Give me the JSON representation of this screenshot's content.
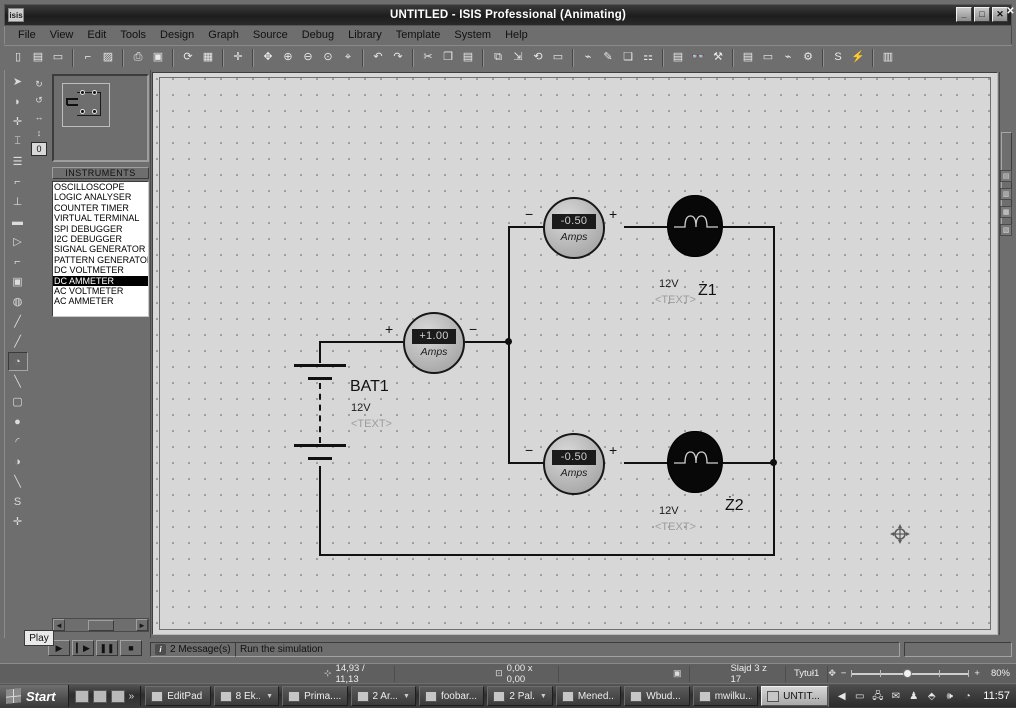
{
  "window": {
    "app_icon_label": "isis",
    "title": "UNTITLED - ISIS Professional (Animating)",
    "minimize": "_",
    "maximize": "□",
    "close": "✕",
    "outer_close": "✕"
  },
  "menu": {
    "items": [
      "File",
      "View",
      "Edit",
      "Tools",
      "Design",
      "Graph",
      "Source",
      "Debug",
      "Library",
      "Template",
      "System",
      "Help"
    ]
  },
  "toolbar": {
    "groups": [
      {
        "buttons": [
          {
            "name": "new-file-button",
            "icon": "new-document-icon",
            "glyph": "▯"
          },
          {
            "name": "open-file-button",
            "icon": "open-folder-icon",
            "glyph": "▤"
          },
          {
            "name": "save-file-button",
            "icon": "save-disk-icon",
            "glyph": "▭"
          }
        ]
      },
      {
        "buttons": [
          {
            "name": "import-section-button",
            "icon": "import-icon",
            "glyph": "⌐"
          },
          {
            "name": "export-section-button",
            "icon": "export-icon",
            "glyph": "▨"
          }
        ]
      },
      {
        "buttons": [
          {
            "name": "print-button",
            "icon": "printer-icon",
            "glyph": "⎙"
          },
          {
            "name": "print-area-button",
            "icon": "print-area-icon",
            "glyph": "▣"
          }
        ]
      },
      {
        "buttons": [
          {
            "name": "refresh-button",
            "icon": "refresh-icon",
            "glyph": "⟳"
          },
          {
            "name": "toggle-grid-button",
            "icon": "grid-icon",
            "glyph": "▦"
          }
        ]
      },
      {
        "buttons": [
          {
            "name": "origin-button",
            "icon": "crosshair-origin-icon",
            "glyph": "✛"
          }
        ]
      },
      {
        "buttons": [
          {
            "name": "pan-button",
            "icon": "pan-move-icon",
            "glyph": "✥"
          },
          {
            "name": "zoom-in-button",
            "icon": "zoom-in-icon",
            "glyph": "⊕"
          },
          {
            "name": "zoom-out-button",
            "icon": "zoom-out-icon",
            "glyph": "⊖"
          },
          {
            "name": "zoom-all-button",
            "icon": "zoom-fit-icon",
            "glyph": "⊙"
          },
          {
            "name": "zoom-area-button",
            "icon": "zoom-area-icon",
            "glyph": "⌖"
          }
        ]
      },
      {
        "buttons": [
          {
            "name": "undo-button",
            "icon": "undo-arrow-icon",
            "glyph": "↶"
          },
          {
            "name": "redo-button",
            "icon": "redo-arrow-icon",
            "glyph": "↷"
          }
        ]
      },
      {
        "buttons": [
          {
            "name": "cut-button",
            "icon": "scissors-icon",
            "glyph": "✂"
          },
          {
            "name": "copy-button",
            "icon": "copy-pages-icon",
            "glyph": "❐"
          },
          {
            "name": "paste-button",
            "icon": "clipboard-icon",
            "glyph": "▤"
          }
        ]
      },
      {
        "buttons": [
          {
            "name": "block-copy-button",
            "icon": "block-copy-icon",
            "glyph": "⧉"
          },
          {
            "name": "block-move-button",
            "icon": "block-move-icon",
            "glyph": "⇲"
          },
          {
            "name": "block-rotate-button",
            "icon": "block-rotate-icon",
            "glyph": "⟲"
          },
          {
            "name": "block-delete-button",
            "icon": "block-delete-icon",
            "glyph": "▭"
          }
        ]
      },
      {
        "buttons": [
          {
            "name": "pick-device-button",
            "icon": "pick-device-icon",
            "glyph": "⌁"
          },
          {
            "name": "make-device-button",
            "icon": "make-device-icon",
            "glyph": "✎"
          },
          {
            "name": "packaging-tool-button",
            "icon": "packaging-icon",
            "glyph": "❏"
          },
          {
            "name": "decompose-button",
            "icon": "decompose-icon",
            "glyph": "⚏"
          }
        ]
      },
      {
        "buttons": [
          {
            "name": "netlist-button",
            "icon": "netlist-icon",
            "glyph": "▤"
          },
          {
            "name": "search-tag-button",
            "icon": "binoculars-icon",
            "glyph": "👓"
          },
          {
            "name": "property-assignment-button",
            "icon": "property-tool-icon",
            "glyph": "⚒"
          }
        ]
      },
      {
        "buttons": [
          {
            "name": "bom-report-button",
            "icon": "bill-of-materials-icon",
            "glyph": "▤"
          },
          {
            "name": "erc-report-button",
            "icon": "erc-icon",
            "glyph": "▭"
          },
          {
            "name": "netlist-compile-button",
            "icon": "compile-icon",
            "glyph": "⌁"
          },
          {
            "name": "ares-button",
            "icon": "ares-pcb-icon",
            "glyph": "⚙"
          }
        ]
      },
      {
        "buttons": [
          {
            "name": "spice-model-button",
            "icon": "spice-icon",
            "glyph": "S"
          },
          {
            "name": "graph-sim-button",
            "icon": "graph-sim-icon",
            "glyph": "⚡"
          }
        ]
      },
      {
        "buttons": [
          {
            "name": "3d-visualizer-button",
            "icon": "three-d-icon",
            "glyph": "▥"
          }
        ]
      }
    ]
  },
  "mode_toolbar": {
    "buttons": [
      {
        "name": "selection-mode-button",
        "icon": "arrow-pointer-icon",
        "glyph": "➤",
        "selected": false
      },
      {
        "name": "component-mode-button",
        "icon": "component-icon",
        "glyph": "◗",
        "selected": false
      },
      {
        "name": "junction-dot-mode-button",
        "icon": "junction-dot-icon",
        "glyph": "✛",
        "selected": false
      },
      {
        "name": "wire-label-mode-button",
        "icon": "wire-label-icon",
        "glyph": "⌶",
        "selected": false
      },
      {
        "name": "text-script-mode-button",
        "icon": "text-script-icon",
        "glyph": "☰",
        "selected": false
      },
      {
        "name": "bus-mode-button",
        "icon": "bus-icon",
        "glyph": "⌐",
        "selected": false
      },
      {
        "name": "subcircuit-mode-button",
        "icon": "subcircuit-icon",
        "glyph": "⊥",
        "selected": false
      },
      {
        "name": "terminals-mode-button",
        "icon": "terminal-icon",
        "glyph": "▬",
        "selected": false
      },
      {
        "name": "device-pin-mode-button",
        "icon": "device-pin-icon",
        "glyph": "▷",
        "selected": false
      },
      {
        "name": "graph-mode-button",
        "icon": "graph-icon",
        "glyph": "⌐",
        "selected": false
      },
      {
        "name": "tape-recorder-mode-button",
        "icon": "tape-recorder-icon",
        "glyph": "▣",
        "selected": false
      },
      {
        "name": "generator-mode-button",
        "icon": "generator-icon",
        "glyph": "◍",
        "selected": false
      },
      {
        "name": "voltage-probe-mode-button",
        "icon": "voltage-probe-icon",
        "glyph": "╱",
        "selected": false
      },
      {
        "name": "current-probe-mode-button",
        "icon": "current-probe-icon",
        "glyph": "╱",
        "selected": false
      },
      {
        "name": "virtual-instruments-mode-button",
        "icon": "instrument-icon",
        "glyph": "◔",
        "selected": true
      },
      {
        "name": "line-mode-button",
        "icon": "line-tool-icon",
        "glyph": "╲",
        "selected": false
      },
      {
        "name": "box-mode-button",
        "icon": "box-tool-icon",
        "glyph": "▢",
        "selected": false
      },
      {
        "name": "circle-mode-button",
        "icon": "circle-tool-icon",
        "glyph": "●",
        "selected": false
      },
      {
        "name": "arc-mode-button",
        "icon": "arc-tool-icon",
        "glyph": "◜",
        "selected": false
      },
      {
        "name": "closed-path-mode-button",
        "icon": "path-tool-icon",
        "glyph": "◑",
        "selected": false
      },
      {
        "name": "text-mode-button",
        "icon": "text-tool-icon",
        "glyph": "╲",
        "selected": false
      },
      {
        "name": "symbol-mode-button",
        "icon": "symbol-icon",
        "glyph": "S",
        "selected": false
      },
      {
        "name": "marker-mode-button",
        "icon": "marker-icon",
        "glyph": "✛",
        "selected": false
      }
    ],
    "orientation_buttons": [
      {
        "name": "rotate-clockwise-button",
        "icon": "rotate-cw-icon",
        "glyph": "↻"
      },
      {
        "name": "rotate-anticlockwise-button",
        "icon": "rotate-ccw-icon",
        "glyph": "↺"
      },
      {
        "name": "mirror-x-button",
        "icon": "mirror-horizontal-icon",
        "glyph": "↔"
      },
      {
        "name": "mirror-y-button",
        "icon": "mirror-vertical-icon",
        "glyph": "↕"
      },
      {
        "name": "rotation-angle-field",
        "icon": "angle-field-icon",
        "glyph": "0"
      }
    ]
  },
  "instruments": {
    "header": "INSTRUMENTS",
    "items": [
      {
        "label": "OSCILLOSCOPE",
        "selected": false
      },
      {
        "label": "LOGIC ANALYSER",
        "selected": false
      },
      {
        "label": "COUNTER TIMER",
        "selected": false
      },
      {
        "label": "VIRTUAL TERMINAL",
        "selected": false
      },
      {
        "label": "SPI DEBUGGER",
        "selected": false
      },
      {
        "label": "I2C DEBUGGER",
        "selected": false
      },
      {
        "label": "SIGNAL GENERATOR",
        "selected": false
      },
      {
        "label": "PATTERN GENERATOR",
        "selected": false
      },
      {
        "label": "DC VOLTMETER",
        "selected": false
      },
      {
        "label": "DC AMMETER",
        "selected": true
      },
      {
        "label": "AC VOLTMETER",
        "selected": false
      },
      {
        "label": "AC AMMETER",
        "selected": false
      }
    ]
  },
  "schematic": {
    "battery": {
      "ref": "BAT1",
      "value": "12V",
      "text": "<TEXT>"
    },
    "ammeters": [
      {
        "name": "ammeter-main",
        "reading": "+1.00",
        "unit": "Amps",
        "left_sign": "+",
        "right_sign": "−"
      },
      {
        "name": "ammeter-branch-1",
        "reading": "-0.50",
        "unit": "Amps",
        "left_sign": "−",
        "right_sign": "+"
      },
      {
        "name": "ammeter-branch-2",
        "reading": "-0.50",
        "unit": "Amps",
        "left_sign": "−",
        "right_sign": "+"
      }
    ],
    "lamps": [
      {
        "ref": "Ż1",
        "value": "12V",
        "text": "<TEXT>"
      },
      {
        "ref": "Ż2",
        "value": "12V",
        "text": "<TEXT>"
      }
    ]
  },
  "animation": {
    "tooltip": "Play",
    "buttons": [
      {
        "name": "play-button",
        "icon": "play-icon",
        "glyph": "▶"
      },
      {
        "name": "step-button",
        "icon": "step-icon",
        "glyph": "▎▶"
      },
      {
        "name": "pause-button",
        "icon": "pause-icon",
        "glyph": "❚❚"
      },
      {
        "name": "stop-button",
        "icon": "stop-icon",
        "glyph": "■"
      }
    ]
  },
  "statusbar": {
    "messages": "2 Message(s)",
    "hint": "Run the simulation"
  },
  "ppt_bar": {
    "coordinates": "14,93 / 11,13",
    "size": "0,00 x 0,00",
    "slide": "Slajd 3 z 17",
    "layout": "Tytuł1",
    "zoom": "80%",
    "zoom_out_label": "−",
    "zoom_in_label": "+"
  },
  "taskbar": {
    "start_label": "Start",
    "quicklaunch": [
      {
        "name": "quicklaunch-item-1",
        "icon": "ie-browser-icon"
      },
      {
        "name": "quicklaunch-item-2",
        "icon": "window-icon"
      },
      {
        "name": "quicklaunch-item-3",
        "icon": "show-desktop-icon"
      },
      {
        "name": "quicklaunch-overflow",
        "icon": "chevron-right-icon",
        "glyph": "»"
      }
    ],
    "tasks": [
      {
        "label": "EditPad",
        "icon": "editpad-icon",
        "active": false,
        "has_arrow": false
      },
      {
        "label": "8 Ek...",
        "icon": "folder-icon",
        "active": false,
        "has_arrow": true
      },
      {
        "label": "Prima....",
        "icon": "prima-icon",
        "active": false,
        "has_arrow": false
      },
      {
        "label": "2 Ar...",
        "icon": "archive-icon",
        "active": false,
        "has_arrow": true
      },
      {
        "label": "foobar...",
        "icon": "foobar2000-icon",
        "active": false,
        "has_arrow": false
      },
      {
        "label": "2 Pal...",
        "icon": "palette-icon",
        "active": false,
        "has_arrow": true
      },
      {
        "label": "Mened...",
        "icon": "task-manager-icon",
        "active": false,
        "has_arrow": false
      },
      {
        "label": "Wbud...",
        "icon": "builtin-icon",
        "active": false,
        "has_arrow": false
      },
      {
        "label": "mwilku...",
        "icon": "globe-icon",
        "active": false,
        "has_arrow": false
      },
      {
        "label": "UNTIT...",
        "icon": "isis-icon",
        "active": true,
        "has_arrow": false
      }
    ],
    "tray": [
      {
        "name": "tray-collapse-button",
        "icon": "chevron-left-icon",
        "glyph": "◀"
      },
      {
        "name": "tray-display-icon",
        "icon": "monitor-icon",
        "glyph": "▭"
      },
      {
        "name": "tray-network-icon",
        "icon": "network-icon",
        "glyph": "🖧"
      },
      {
        "name": "tray-mail-icon",
        "icon": "envelope-icon",
        "glyph": "✉"
      },
      {
        "name": "tray-security-icon",
        "icon": "shield-icon",
        "glyph": "♟"
      },
      {
        "name": "tray-update-icon",
        "icon": "update-arrow-icon",
        "glyph": "⬘"
      },
      {
        "name": "tray-volume-icon",
        "icon": "speaker-icon",
        "glyph": "🕪"
      },
      {
        "name": "tray-clock-icon",
        "icon": "clock-icon",
        "glyph": "◔"
      }
    ],
    "clock": "11:57"
  }
}
